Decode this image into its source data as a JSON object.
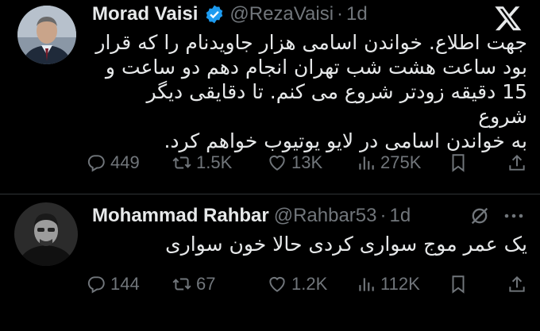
{
  "tweets": [
    {
      "author_name": "Morad Vaisi",
      "verified": true,
      "handle": "@RezaVaisi",
      "separator": "·",
      "time": "1d",
      "text_lines": [
        "جهت اطلاع. خواندن اسامی هزار جاویدنام را که قرار",
        "بود ساعت هشت شب تهران انجام دهم دو ساعت و",
        "15 دقیقه زودتر شروع می کنم. تا دقایقی دیگر شروع",
        "به خواندن اسامی در لایو یوتیوب خواهم کرد."
      ],
      "replies": "449",
      "retweets": "1.5K",
      "likes": "13K",
      "views": "275K",
      "icons": [
        "x-logo-icon",
        "verified-badge-icon",
        "reply-icon",
        "retweet-icon",
        "like-icon",
        "views-icon",
        "bookmark-icon",
        "share-icon"
      ]
    },
    {
      "author_name": "Mohammad Rahbar",
      "handle": "@Rahbar53",
      "separator": "·",
      "time": "1d",
      "text_lines": [
        "یک عمر موج سواری کردی حالا خون سواری"
      ],
      "replies": "144",
      "retweets": "67",
      "likes": "1.2K",
      "views": "112K",
      "icons": [
        "muted-icon",
        "more-icon",
        "reply-icon",
        "retweet-icon",
        "like-icon",
        "views-icon",
        "bookmark-icon",
        "share-icon"
      ]
    }
  ],
  "colors": {
    "background": "#000000",
    "text_primary": "#e7e9ea",
    "text_secondary": "#71767b",
    "verified_blue": "#1d9bf0",
    "divider": "#2f3336"
  }
}
